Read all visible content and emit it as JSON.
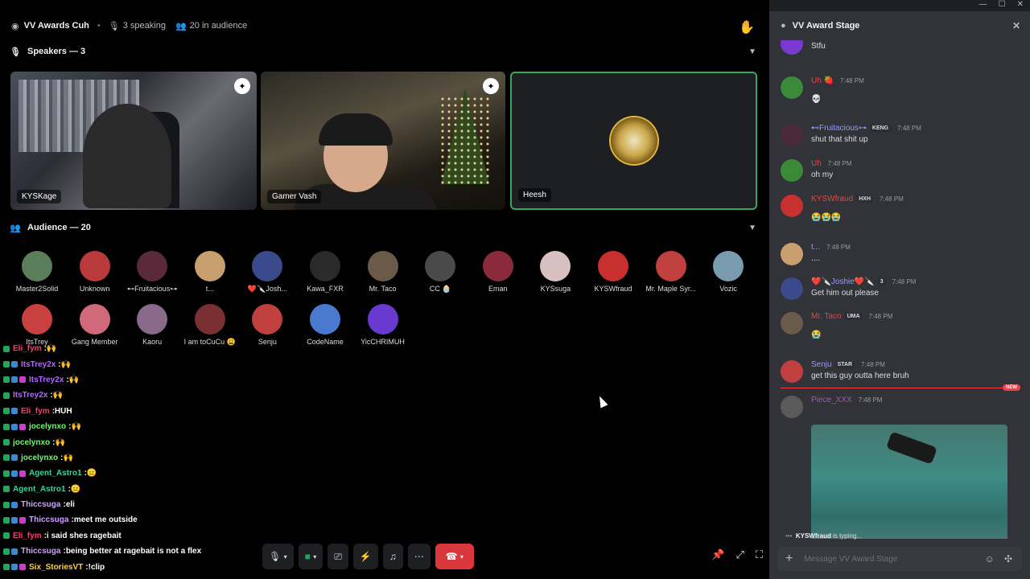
{
  "stage": {
    "title": "VV Awards Cuh",
    "speaking": "3 speaking",
    "audience_count": "20 in audience",
    "speakers_label": "Speakers — 3",
    "audience_label": "Audience — 20"
  },
  "speakers": [
    {
      "name": "KYSKage"
    },
    {
      "name": "Gamer Vash"
    },
    {
      "name": "Heesh"
    }
  ],
  "audience": [
    {
      "name": "Master2Solid",
      "color": "#5a7d5a"
    },
    {
      "name": "Unknown",
      "color": "#b83a3a"
    },
    {
      "name": "⊷Fruitacious⊶",
      "color": "#5a2a3a"
    },
    {
      "name": "t...",
      "color": "#c8a070"
    },
    {
      "name": "❤️🔪Josh...",
      "color": "#3a4a8a"
    },
    {
      "name": "Kawa_FXR",
      "color": "#2a2a2a"
    },
    {
      "name": "Mr. Taco",
      "color": "#6a5a4a"
    },
    {
      "name": "CC 🧁",
      "color": "#4a4a4a"
    },
    {
      "name": "Eman",
      "color": "#8a2a3a"
    },
    {
      "name": "KYSsuga",
      "color": "#d8c0c0"
    },
    {
      "name": "KYSWfraud",
      "color": "#c83030"
    },
    {
      "name": "Mr. Maple Syr...",
      "color": "#c04040"
    },
    {
      "name": "Vozic",
      "color": "#7a9ab0"
    },
    {
      "name": "ItsTrey",
      "color": "#c84040"
    },
    {
      "name": "Gang Member",
      "color": "#d06a7a"
    },
    {
      "name": "Kaoru",
      "color": "#8a6a8a"
    },
    {
      "name": "I am toCuCu 😩",
      "color": "#7a3030"
    },
    {
      "name": "Senju",
      "color": "#c04040"
    },
    {
      "name": "CodeName",
      "color": "#4a7ad0"
    },
    {
      "name": "YicCHRIMUH",
      "color": "#6a3ad0"
    }
  ],
  "chat": [
    {
      "user": "Eli_fym",
      "msg": "🙌",
      "color": "#ff3b6b"
    },
    {
      "user": "ItsTrey2x",
      "msg": "🙌",
      "color": "#b06aff"
    },
    {
      "user": "ItsTrey2x",
      "msg": "🙌",
      "color": "#b06aff"
    },
    {
      "user": "ItsTrey2x",
      "msg": "🙌",
      "color": "#b06aff"
    },
    {
      "user": "Eli_fym",
      "msg": "HUH",
      "color": "#ff3b6b"
    },
    {
      "user": "jocelynxo",
      "msg": "🙌",
      "color": "#6aff6a"
    },
    {
      "user": "jocelynxo",
      "msg": "🙌",
      "color": "#6aff6a"
    },
    {
      "user": "jocelynxo",
      "msg": "🙌",
      "color": "#6aff6a"
    },
    {
      "user": "Agent_Astro1",
      "msg": "😐",
      "color": "#3ad0a0"
    },
    {
      "user": "Agent_Astro1",
      "msg": "😐",
      "color": "#3ad0a0"
    },
    {
      "user": "Thiccsuga",
      "msg": "eli",
      "color": "#d0a0ff"
    },
    {
      "user": "Thiccsuga",
      "msg": "meet me outside",
      "color": "#d0a0ff"
    },
    {
      "user": "Eli_fym",
      "msg": "i said shes ragebait",
      "color": "#ff3b6b"
    },
    {
      "user": "Thiccsuga",
      "msg": "being better at ragebait is not a flex",
      "color": "#d0a0ff"
    },
    {
      "user": "Six_StoriesVT",
      "msg": "!clip",
      "color": "#ffd23a"
    }
  ],
  "panel": {
    "title": "VV Award Stage",
    "messages": [
      {
        "user": "",
        "text": "Stfu",
        "time": ""
      },
      {
        "user": "Uh 🍓",
        "text": "💀",
        "time": "7:48 PM",
        "color": "#f23f43"
      },
      {
        "user": "⊷Fruitacious⊶",
        "tag": "KENG",
        "text": "shut that shit up",
        "time": "7:48 PM",
        "color": "#949cf7"
      },
      {
        "user": "Uh",
        "text": "oh my",
        "time": "7:48 PM",
        "color": "#f23f43"
      },
      {
        "user": "KYSWfraud",
        "tag": "HXH",
        "text": "😭😭😭",
        "time": "7:48 PM",
        "color": "#f23f43"
      },
      {
        "user": "t...",
        "text": "....",
        "time": "7:48 PM",
        "color": "#949cf7"
      },
      {
        "user": "❤️🔪Joshie❤️🔪",
        "tag": "3",
        "text": "Get him out please",
        "time": "7:48 PM",
        "color": "#949cf7"
      },
      {
        "user": "Mr. Taco",
        "tag": "UMA",
        "text": "😭",
        "time": "7:48 PM",
        "color": "#f23f43"
      },
      {
        "user": "Senju",
        "tag": "STAR",
        "text": "get this guy outta here bruh",
        "time": "7:48 PM",
        "color": "#949cf7"
      },
      {
        "user": "Piece_XXX",
        "text": "",
        "time": "7:48 PM",
        "color": "#9b59b6"
      }
    ],
    "new_label": "NEW",
    "typing_user": "KYSWfraud",
    "typing_suffix": " is typing...",
    "composer_placeholder": "Message VV Award Stage"
  }
}
